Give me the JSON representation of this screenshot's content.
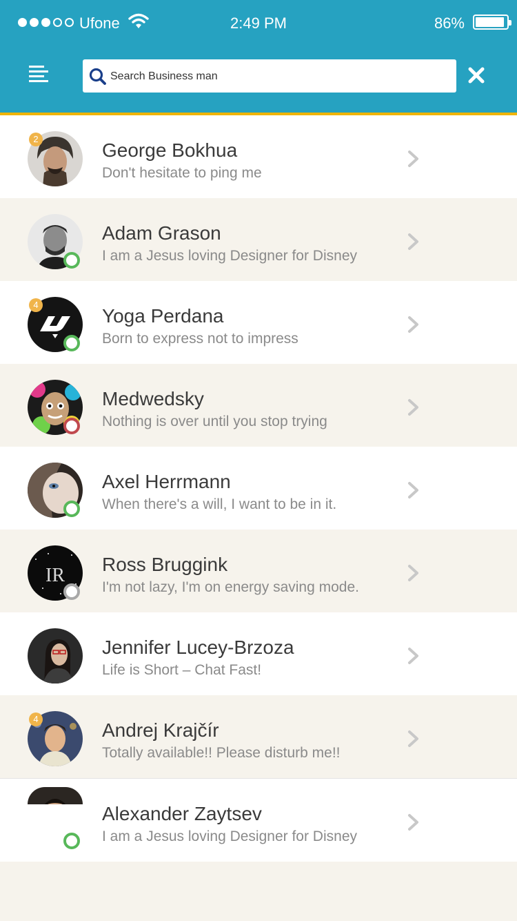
{
  "status_bar": {
    "carrier": "Ufone",
    "time": "2:49 PM",
    "battery": "86%",
    "battery_level": 0.86,
    "signal_bars_filled": 3,
    "signal_bars_total": 5
  },
  "header": {
    "menu_icon": "menu-icon",
    "search_placeholder": "Search Business man",
    "close_icon": "close-icon"
  },
  "colors": {
    "header": "#26a2c1",
    "accent_line": "#f0b400",
    "badge": "#f0b44a",
    "online": "#58b85a",
    "busy": "#c0494e",
    "away": "#a8a8a8"
  },
  "contacts": [
    {
      "name": "George Bokhua",
      "message": "Don't hesitate to ping me",
      "badge": "2",
      "status": "none",
      "avatar": "avatar-george"
    },
    {
      "name": "Adam Grason",
      "message": "I am a Jesus loving Designer for Disney",
      "badge": "",
      "status": "online",
      "avatar": "avatar-adam"
    },
    {
      "name": "Yoga Perdana",
      "message": "Born to express not to impress",
      "badge": "4",
      "status": "online",
      "avatar": "avatar-yoga"
    },
    {
      "name": "Medwedsky",
      "message": "Nothing is over until you stop trying",
      "badge": "",
      "status": "busy",
      "avatar": "avatar-medwedsky"
    },
    {
      "name": "Axel Herrmann",
      "message": "When there's a will, I want to be in it.",
      "badge": "",
      "status": "online",
      "avatar": "avatar-axel"
    },
    {
      "name": "Ross Bruggink",
      "message": "I'm not lazy, I'm on energy saving mode.",
      "badge": "",
      "status": "away",
      "avatar": "avatar-ross"
    },
    {
      "name": "Jennifer Lucey-Brzoza",
      "message": "Life is Short – Chat Fast!",
      "badge": "",
      "status": "none",
      "avatar": "avatar-jennifer"
    },
    {
      "name": "Andrej Krajčír",
      "message": "Totally available!! Please disturb me!!",
      "badge": "4",
      "status": "none",
      "avatar": "avatar-andrej"
    },
    {
      "name": "Alexander Zaytsev",
      "message": "I am a Jesus loving Designer for Disney",
      "badge": "",
      "status": "online",
      "avatar": "avatar-alexander"
    }
  ]
}
